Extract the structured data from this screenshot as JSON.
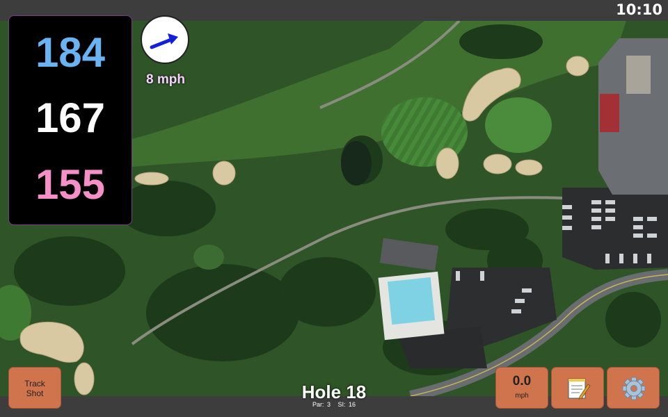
{
  "status": {
    "time": "10:10"
  },
  "distances": {
    "back": "184",
    "middle": "167",
    "front": "155"
  },
  "wind": {
    "speed": "8 mph",
    "icon": "wind-direction-arrow-icon"
  },
  "buttons": {
    "track_shot_line1": "Track",
    "track_shot_line2": "Shot",
    "speed_value": "0.0",
    "speed_unit": "mph",
    "notes_icon": "notepad-icon",
    "settings_icon": "gear-icon"
  },
  "hole": {
    "title": "Hole 18",
    "par": "Par: 3",
    "si": "SI: 16"
  },
  "colors": {
    "back_distance": "#6ab3f3",
    "middle_distance": "#ffffff",
    "front_distance": "#f48fc8",
    "button_orange": "#d0744d",
    "wind_text": "#f6d2ff"
  }
}
